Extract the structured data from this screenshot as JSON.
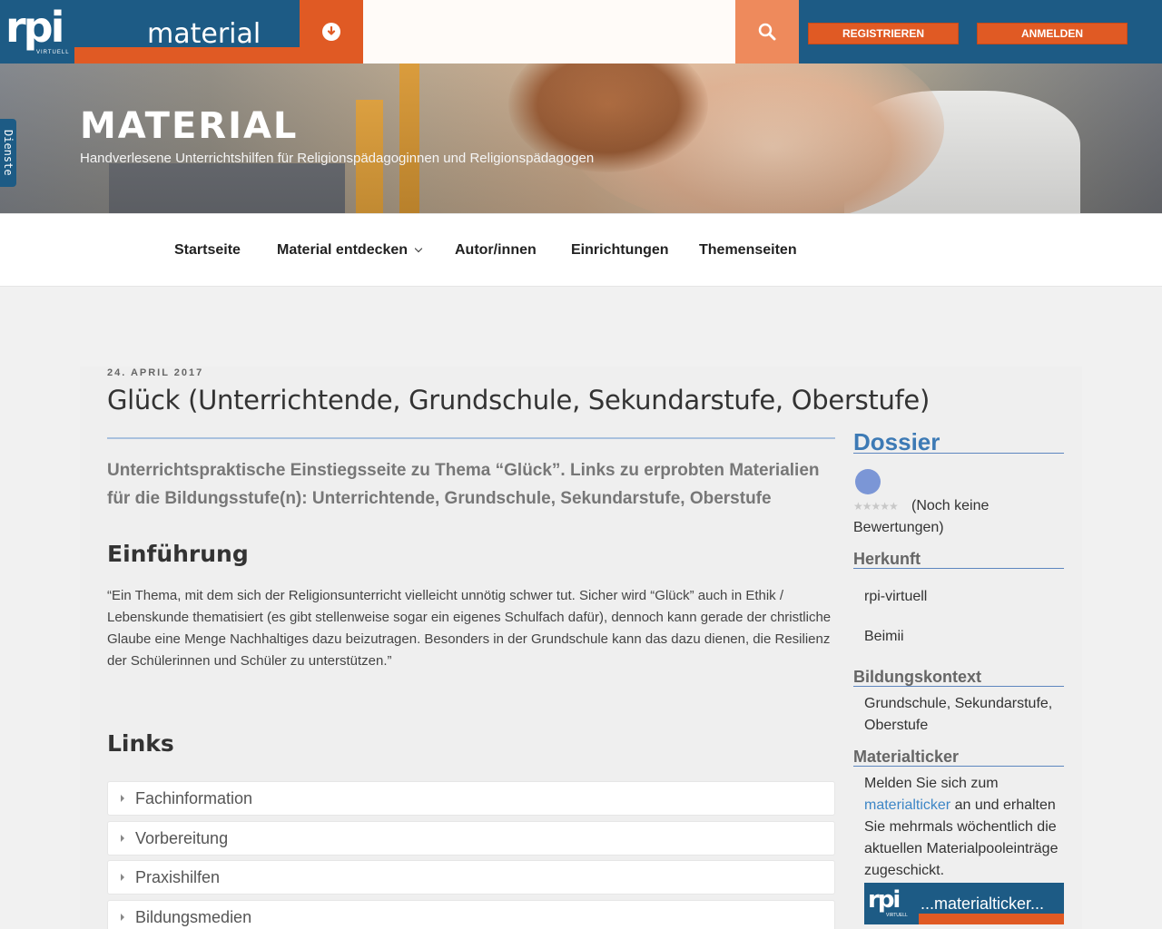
{
  "header": {
    "logo_text": "rpi",
    "logo_sub": "VIRTUELL",
    "site_name": "material",
    "search": {
      "value": "",
      "placeholder": ""
    },
    "register_label": "REGISTRIEREN",
    "login_label": "ANMELDEN",
    "icons": {
      "download": "download-circle-icon",
      "search": "search-icon"
    },
    "colors": {
      "blue": "#1d5b85",
      "orange": "#e05a24",
      "light_orange": "#ee8a5c"
    }
  },
  "hero": {
    "title": "MATERIAL",
    "subtitle": "Handverlesene Unterrichtshilfen für Religionspädagoginnen und Religionspädagogen",
    "side_tab": "Dienste"
  },
  "nav": {
    "items": [
      {
        "label": "Startseite"
      },
      {
        "label": "Material entdecken",
        "has_dropdown": true
      },
      {
        "label": "Autor/innen"
      },
      {
        "label": "Einrichtungen"
      },
      {
        "label": "Themenseiten"
      }
    ]
  },
  "article": {
    "date": "24. APRIL 2017",
    "title": "Glück (Unterrichtende, Grundschule, Sekundarstufe, Oberstufe)",
    "lead": "Unterrichtspraktische Einstiegsseite zu Thema “Glück”. Links zu erprobten Materialien für die Bildungsstufe(n): Unterrichtende, Grundschule, Sekundarstufe, Oberstufe",
    "intro_heading": "Einführung",
    "intro_text": "“Ein Thema, mit dem sich der Religionsunterricht vielleicht unnötig schwer tut. Sicher wird “Glück” auch in Ethik / Lebenskunde thematisiert (es gibt stellenweise sogar ein eigenes Schulfach dafür), dennoch kann gerade der christliche Glaube eine Menge Nachhaltiges dazu beizutragen. Besonders in der Grundschule kann das dazu dienen, die Resilienz der Schülerinnen und Schüler zu unterstützen.”",
    "links_heading": "Links",
    "accordion": [
      {
        "label": "Fachinformation"
      },
      {
        "label": "Vorbereitung"
      },
      {
        "label": "Praxishilfen"
      },
      {
        "label": "Bildungsmedien"
      }
    ]
  },
  "sidebar": {
    "dossier_heading": "Dossier",
    "rating_text": "(Noch keine Bewertungen)",
    "stars_glyphs": "★★★★★",
    "herkunft_heading": "Herkunft",
    "herkunft_items": [
      "rpi-virtuell",
      "Beimii"
    ],
    "bildungskontext_heading": "Bildungskontext",
    "bildungskontext_value": "Grundschule, Sekundarstufe, Oberstufe",
    "materialticker_heading": "Materialticker",
    "materialticker_text_before": "Melden Sie sich zum ",
    "materialticker_link": "materialticker",
    "materialticker_text_after": " an und erhalten Sie mehrmals wöchentlich die aktuellen Materialpooleinträge zugeschickt.",
    "banner_logo": "rpi",
    "banner_logo_sub": "VIRTUELL",
    "banner_text": "...materialticker..."
  }
}
